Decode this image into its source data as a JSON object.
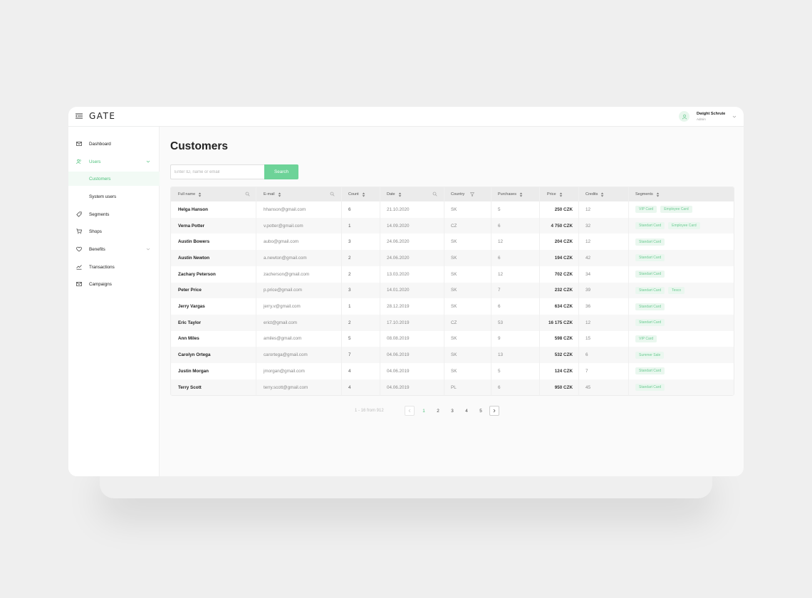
{
  "app": {
    "logo": "GATE"
  },
  "user": {
    "name": "Dwight Schrute",
    "role": "Admin"
  },
  "sidebar": {
    "items": [
      {
        "label": "Dashboard"
      },
      {
        "label": "Users"
      },
      {
        "label": "Customers"
      },
      {
        "label": "System users"
      },
      {
        "label": "Segments"
      },
      {
        "label": "Shops"
      },
      {
        "label": "Benefits"
      },
      {
        "label": "Transactions"
      },
      {
        "label": "Campaigns"
      }
    ]
  },
  "page": {
    "title": "Customers"
  },
  "search": {
    "placeholder": "Enter ID, name or email",
    "button": "Search"
  },
  "table": {
    "columns": [
      "Full name",
      "E-mail",
      "Count",
      "Date",
      "Country",
      "Purchases",
      "Price",
      "Credits",
      "Segments"
    ],
    "rows": [
      {
        "name": "Helga Hanson",
        "email": "hhanson@gmail.com",
        "count": "6",
        "date": "21.10.2020",
        "country": "SK",
        "purchases": "5",
        "price": "250 CZK",
        "credits": "12",
        "segments": [
          "VIP Card",
          "Employee Card"
        ]
      },
      {
        "name": "Verna Potter",
        "email": "v.potter@gmail.com",
        "count": "1",
        "date": "14.09.2020",
        "country": "CZ",
        "purchases": "6",
        "price": "4 750 CZK",
        "credits": "32",
        "segments": [
          "Standart Card",
          "Employee Card"
        ]
      },
      {
        "name": "Austin Bowers",
        "email": "aubo@gmail.com",
        "count": "3",
        "date": "24.06.2020",
        "country": "SK",
        "purchases": "12",
        "price": "204 CZK",
        "credits": "12",
        "segments": [
          "Standart Card"
        ]
      },
      {
        "name": "Austin Newton",
        "email": "a.newton@gmail.com",
        "count": "2",
        "date": "24.06.2020",
        "country": "SK",
        "purchases": "6",
        "price": "194 CZK",
        "credits": "42",
        "segments": [
          "Standart Card"
        ]
      },
      {
        "name": "Zachary Peterson",
        "email": "zacherson@gmail.com",
        "count": "2",
        "date": "13.03.2020",
        "country": "SK",
        "purchases": "12",
        "price": "702 CZK",
        "credits": "34",
        "segments": [
          "Standart Card"
        ]
      },
      {
        "name": "Peter Price",
        "email": "p.price@gmail.com",
        "count": "3",
        "date": "14.01.2020",
        "country": "SK",
        "purchases": "7",
        "price": "232 CZK",
        "credits": "39",
        "segments": [
          "Standart Card",
          "Tesco"
        ]
      },
      {
        "name": "Jerry Vargas",
        "email": "jerry.v@gmail.com",
        "count": "1",
        "date": "28.12.2019",
        "country": "SK",
        "purchases": "6",
        "price": "634 CZK",
        "credits": "36",
        "segments": [
          "Standart Card"
        ]
      },
      {
        "name": "Eric Taylor",
        "email": "erict@gmail.com",
        "count": "2",
        "date": "17.10.2019",
        "country": "CZ",
        "purchases": "53",
        "price": "16 175 CZK",
        "credits": "12",
        "segments": [
          "Standart Card"
        ]
      },
      {
        "name": "Ann Miles",
        "email": "amiles@gmail.com",
        "count": "5",
        "date": "08.08.2019",
        "country": "SK",
        "purchases": "9",
        "price": "598 CZK",
        "credits": "15",
        "segments": [
          "VIP Card"
        ]
      },
      {
        "name": "Carolyn Ortega",
        "email": "carortega@gmail.com",
        "count": "7",
        "date": "04.06.2019",
        "country": "SK",
        "purchases": "13",
        "price": "532 CZK",
        "credits": "6",
        "segments": [
          "Summer Sale"
        ]
      },
      {
        "name": "Justin Morgan",
        "email": "jmorgan@gmail.com",
        "count": "4",
        "date": "04.06.2019",
        "country": "SK",
        "purchases": "5",
        "price": "124 CZK",
        "credits": "7",
        "segments": [
          "Standart Card"
        ]
      },
      {
        "name": "Terry Scott",
        "email": "terry.scott@gmail.com",
        "count": "4",
        "date": "04.06.2019",
        "country": "PL",
        "purchases": "6",
        "price": "950 CZK",
        "credits": "45",
        "segments": [
          "Standart Card"
        ]
      }
    ]
  },
  "pagination": {
    "info": "1 - 16 from 912",
    "pages": [
      "1",
      "2",
      "3",
      "4",
      "5"
    ],
    "current": "1"
  },
  "colors": {
    "accent": "#6dd398",
    "accent_text": "#4cc07a",
    "tag_bg": "#eaf7ef"
  }
}
